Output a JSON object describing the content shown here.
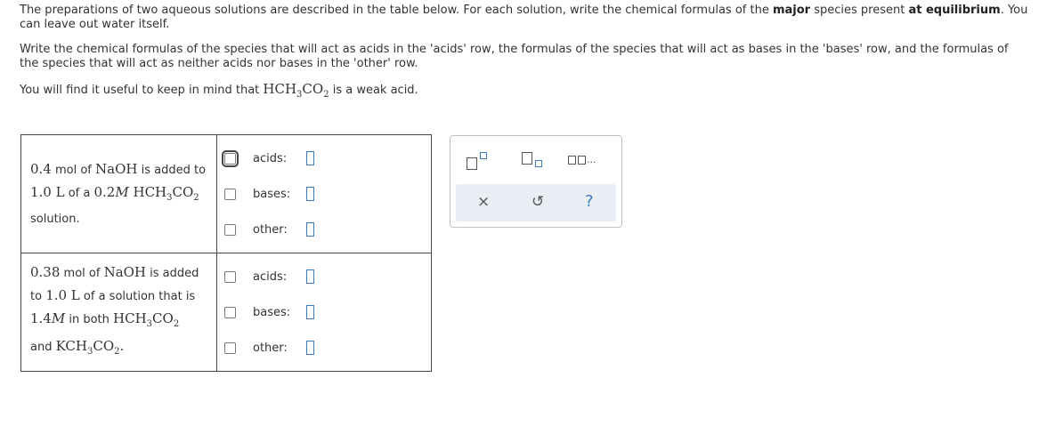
{
  "intro": {
    "p1_a": "The preparations of two aqueous solutions are described in the table below. For each solution, write the chemical formulas of the ",
    "p1_bold1": "major",
    "p1_b": " species present ",
    "p1_bold2": "at equilibrium",
    "p1_c": ". You can leave out water itself.",
    "p2": "Write the chemical formulas of the species that will act as acids in the 'acids' row, the formulas of the species that will act as bases in the 'bases' row, and the formulas of the species that will act as neither acids nor bases in the 'other' row.",
    "p3_a": "You will find it useful to keep in mind that ",
    "p3_formula": "HCH",
    "p3_sub1": "3",
    "p3_formula2": "CO",
    "p3_sub2": "2",
    "p3_b": " is a weak acid."
  },
  "solutions": [
    {
      "desc": {
        "l1_num": "0.4",
        "l1_text": " mol of ",
        "l1_chem": "NaOH",
        "l1_tail": " is added to",
        "l2_vol": "1.0 L",
        "l2_text": " of a ",
        "l2_conc": "0.2",
        "l2_unit": "M",
        "l2_chem_a": " HCH",
        "l2_sub1": "3",
        "l2_chem_b": "CO",
        "l2_sub2": "2",
        "l3": "solution."
      },
      "rows": [
        {
          "label": "acids:"
        },
        {
          "label": "bases:"
        },
        {
          "label": "other:"
        }
      ]
    },
    {
      "desc": {
        "l1_num": "0.38",
        "l1_text": " mol of ",
        "l1_chem": "NaOH",
        "l1_tail": " is added",
        "l2_text": "to a solution that is",
        "l2_vol": "1.0 L",
        "l2_pre": "to ",
        "l2_post": " of a solution that is",
        "l3_conc": "1.4",
        "l3_unit": "M",
        "l3_text": " in both ",
        "l3_chem_a": "HCH",
        "l3_sub1": "3",
        "l3_chem_b": "CO",
        "l3_sub2": "2",
        "l4_text": "and ",
        "l4_chem_a": "KCH",
        "l4_sub1": "3",
        "l4_chem_b": "CO",
        "l4_sub2": "2",
        "l4_end": "."
      },
      "rows": [
        {
          "label": "acids:"
        },
        {
          "label": "bases:"
        },
        {
          "label": "other:"
        }
      ]
    }
  ],
  "palette": {
    "icons": [
      "superscript-template-icon",
      "subscript-template-icon",
      "list-template-icon",
      "clear-icon",
      "undo-icon",
      "help-icon"
    ],
    "dots": "...",
    "clear": "×",
    "undo": "↺",
    "help": "?",
    "accent": "#3a7ab8"
  }
}
